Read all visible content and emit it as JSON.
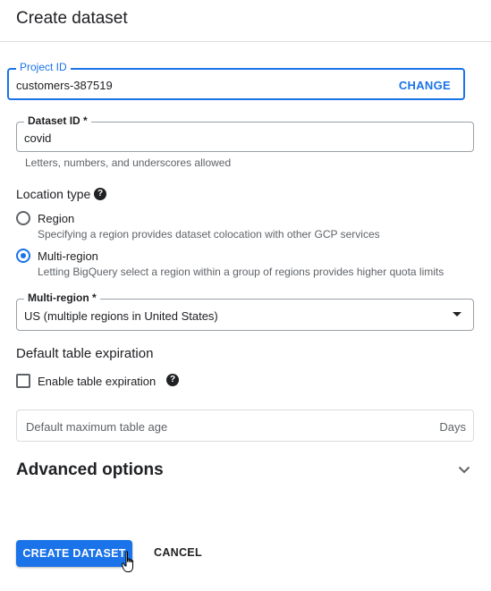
{
  "header": {
    "title": "Create dataset"
  },
  "project": {
    "label": "Project ID",
    "value": "customers-387519",
    "change_label": "CHANGE"
  },
  "dataset": {
    "label": "Dataset ID *",
    "value": "covid",
    "hint": "Letters, numbers, and underscores allowed"
  },
  "location": {
    "label": "Location type",
    "help_icon": "help-icon",
    "options": [
      {
        "label": "Region",
        "description": "Specifying a region provides dataset colocation with other GCP services",
        "selected": false
      },
      {
        "label": "Multi-region",
        "description": "Letting BigQuery select a region within a group of regions provides higher quota limits",
        "selected": true
      }
    ]
  },
  "multiregion": {
    "label": "Multi-region *",
    "value": "US (multiple regions in United States)"
  },
  "expiration": {
    "heading": "Default table expiration",
    "checkbox_label": "Enable table expiration",
    "checked": false,
    "age_placeholder": "Default maximum table age",
    "suffix": "Days"
  },
  "advanced": {
    "label": "Advanced options",
    "expanded": false
  },
  "actions": {
    "create_label": "CREATE DATASET",
    "cancel_label": "CANCEL"
  },
  "colors": {
    "accent": "#1a73e8",
    "text": "#202124",
    "muted": "#5f6368",
    "border": "#dadce0"
  }
}
